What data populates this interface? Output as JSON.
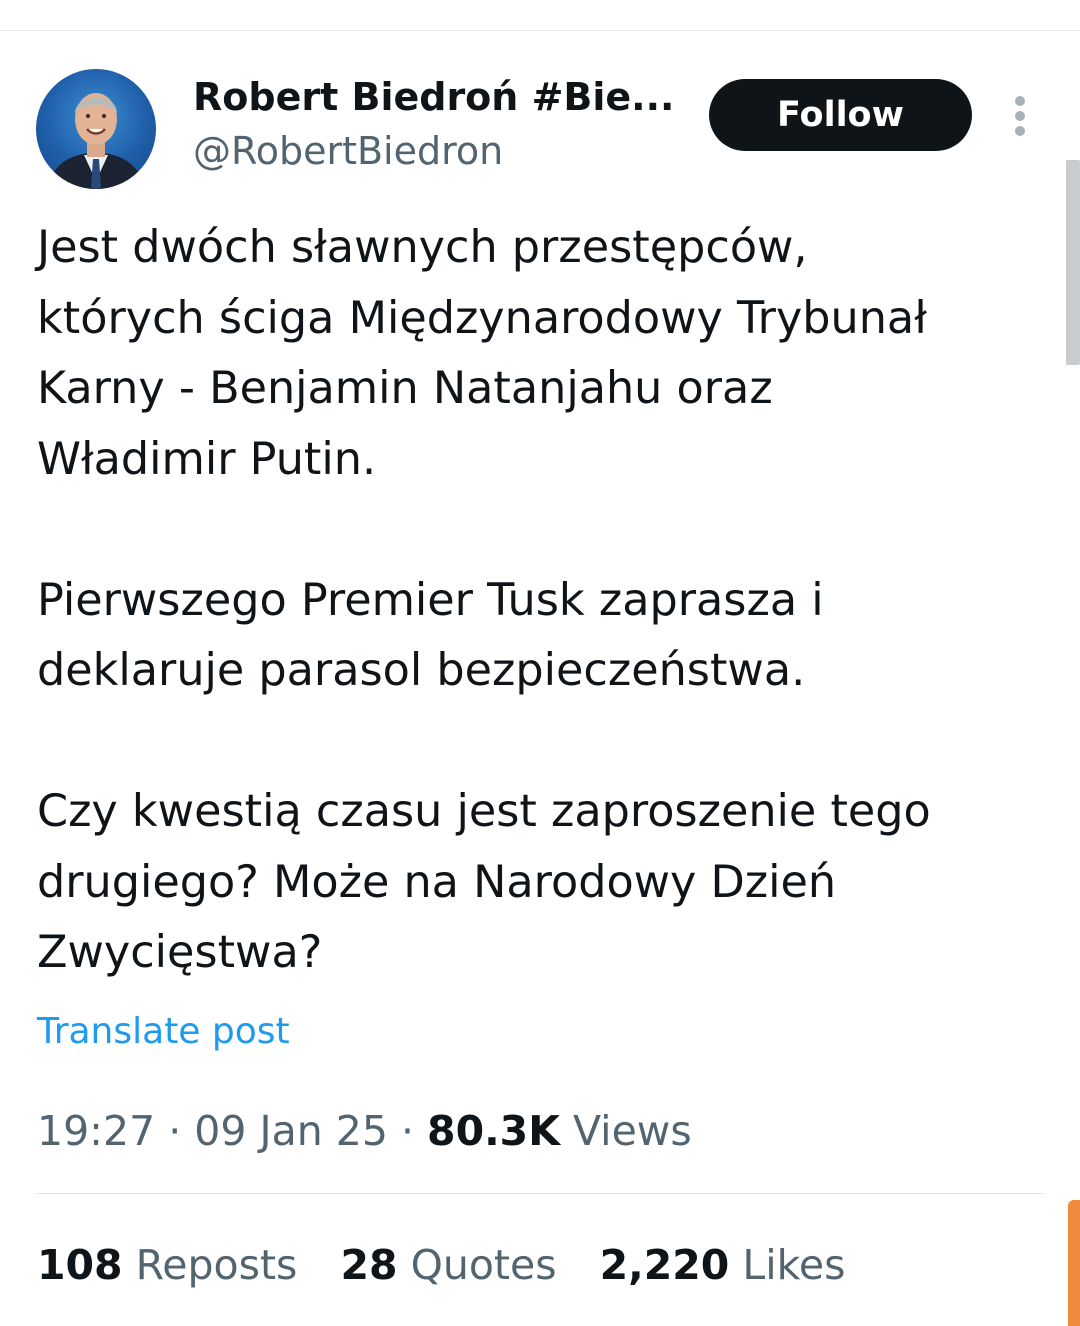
{
  "author": {
    "display_name": "Robert Biedroń #Bie...",
    "handle": "@RobertBiedron"
  },
  "follow_button": {
    "label": "Follow"
  },
  "post": {
    "text": "Jest dwóch sławnych przestępców,\nktórych ściga Międzynarodowy Trybunał\nKarny - Benjamin Natanjahu oraz\nWładimir Putin.\n\nPierwszego Premier Tusk zaprasza i\ndeklaruje parasol bezpieczeństwa.\n\nCzy kwestią czasu jest zaproszenie tego\ndrugiego? Może na Narodowy Dzień\nZwycięstwa?",
    "translate_label": "Translate post"
  },
  "meta": {
    "time": "19:27",
    "separator": "·",
    "date": "09 Jan 25",
    "views_count": "80.3K",
    "views_label": "Views"
  },
  "stats": {
    "reposts": {
      "count": "108",
      "label": "Reposts"
    },
    "quotes": {
      "count": "28",
      "label": "Quotes"
    },
    "likes": {
      "count": "2,220",
      "label": "Likes"
    }
  },
  "icons": {
    "more": "more-vertical-icon",
    "avatar": "profile-photo"
  },
  "colors": {
    "text_primary": "#0f1419",
    "text_secondary": "#536471",
    "link": "#1d9bf0",
    "button_bg": "#0f1419"
  }
}
